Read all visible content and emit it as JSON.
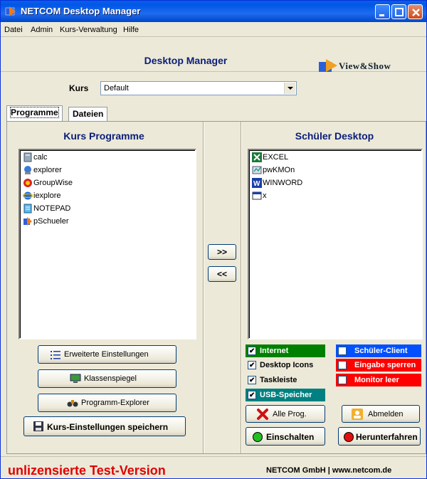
{
  "window": {
    "title": "NETCOM Desktop Manager",
    "controls": {
      "minimize": "minimize-icon",
      "maximize": "maximize-icon",
      "close": "close-icon"
    }
  },
  "menu": {
    "items": [
      "Datei",
      "Admin",
      "Kurs-Verwaltung",
      "Hilfe"
    ]
  },
  "header": {
    "title": "Desktop Manager",
    "logo_text": "View&Show"
  },
  "kurs": {
    "label": "Kurs",
    "selected": "Default"
  },
  "tabs": [
    {
      "label": "Programme",
      "active": true
    },
    {
      "label": "Dateien",
      "active": false
    }
  ],
  "left": {
    "title": "Kurs Programme",
    "items": [
      {
        "label": "calc",
        "icon": "calculator-icon"
      },
      {
        "label": "explorer",
        "icon": "explorer-icon"
      },
      {
        "label": "GroupWise",
        "icon": "groupwise-icon"
      },
      {
        "label": "iexplore",
        "icon": "internet-explorer-icon"
      },
      {
        "label": "NOTEPAD",
        "icon": "notepad-icon"
      },
      {
        "label": "pSchueler",
        "icon": "pschueler-icon"
      }
    ],
    "buttons": {
      "erweitert": "Erweiterte Einstellungen",
      "klassenspiegel": "Klassenspiegel",
      "explorer": "Programm-Explorer",
      "save": "Kurs-Einstellungen speichern"
    }
  },
  "move": {
    "add": ">>",
    "remove": "<<"
  },
  "right": {
    "title": "Schüler Desktop",
    "items": [
      {
        "label": "EXCEL",
        "icon": "excel-icon"
      },
      {
        "label": "pwKMOn",
        "icon": "pwkmon-icon"
      },
      {
        "label": "WINWORD",
        "icon": "word-icon"
      },
      {
        "label": "x",
        "icon": "window-icon"
      }
    ]
  },
  "options": {
    "internet": {
      "label": "Internet",
      "checked": true,
      "color": "#008000"
    },
    "desktop_icons": {
      "label": "Desktop Icons",
      "checked": true
    },
    "taskleiste": {
      "label": "Taskleiste",
      "checked": true
    },
    "usb": {
      "label": "USB-Speicher",
      "checked": true,
      "color": "#008080"
    },
    "schueler_client": {
      "label": "Schüler-Client",
      "checked": false,
      "color": "#0050ff"
    },
    "eingabe_sperren": {
      "label": "Eingabe sperren",
      "checked": false,
      "color": "#ff0000"
    },
    "monitor_leer": {
      "label": "Monitor leer",
      "checked": false,
      "color": "#ff0000"
    }
  },
  "actions": {
    "alle_prog": "Alle Prog.",
    "abmelden": "Abmelden",
    "einschalten": "Einschalten",
    "herunterfahren": "Herunterfahren"
  },
  "status": {
    "warning": "unlizensierte Test-Version",
    "company": "NETCOM GmbH | www.netcom.de"
  }
}
